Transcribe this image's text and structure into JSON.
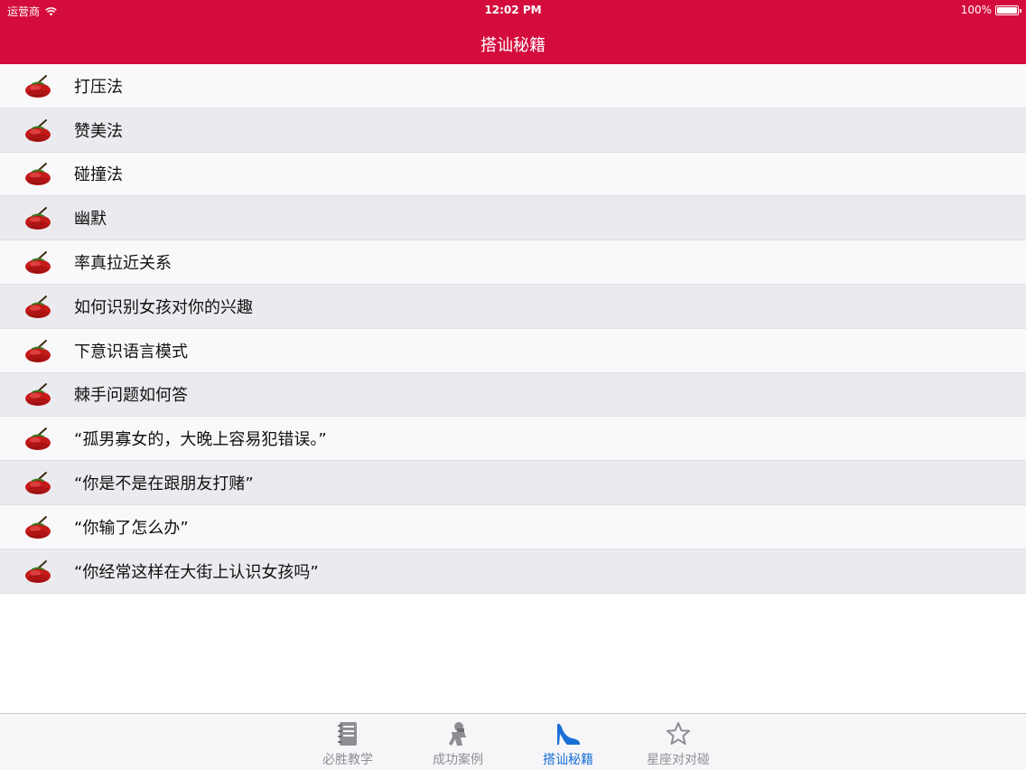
{
  "status_bar": {
    "carrier": "运营商",
    "time": "12:02 PM",
    "battery": "100%"
  },
  "nav": {
    "title": "搭讪秘籍"
  },
  "list": {
    "icon": "tomato-icon",
    "items": [
      {
        "label": "打压法"
      },
      {
        "label": "赞美法"
      },
      {
        "label": "碰撞法"
      },
      {
        "label": "幽默"
      },
      {
        "label": "率真拉近关系"
      },
      {
        "label": "如何识别女孩对你的兴趣"
      },
      {
        "label": "下意识语言模式"
      },
      {
        "label": "棘手问题如何答"
      },
      {
        "label": "“孤男寡女的，大晚上容易犯错误。”"
      },
      {
        "label": "“你是不是在跟朋友打赌”"
      },
      {
        "label": "“你输了怎么办”"
      },
      {
        "label": "“你经常这样在大街上认识女孩吗”"
      }
    ]
  },
  "tabbar": {
    "tabs": [
      {
        "label": "必胜教学",
        "icon": "notebook-icon",
        "active": false
      },
      {
        "label": "成功案例",
        "icon": "figure-icon",
        "active": false
      },
      {
        "label": "搭讪秘籍",
        "icon": "high-heel-icon",
        "active": true
      },
      {
        "label": "星座对对碰",
        "icon": "star-icon",
        "active": false
      }
    ]
  },
  "colors": {
    "brand": "#d40c3d",
    "active_tab": "#1a6fd6",
    "inactive_tab": "#8e8e93"
  }
}
